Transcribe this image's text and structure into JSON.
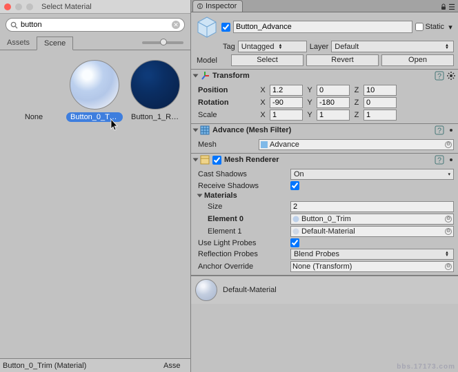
{
  "picker": {
    "title": "Select Material",
    "search_value": "button",
    "tabs": {
      "assets": "Assets",
      "scene": "Scene"
    },
    "items": {
      "none": "None",
      "sel": "Button_0_Tr…",
      "dark": "Button_1_Re..."
    },
    "footer_left": "Button_0_Trim (Material)",
    "footer_right": "Asse"
  },
  "inspector": {
    "tab": "Inspector",
    "name": "Button_Advance",
    "static_label": "Static",
    "tag_label": "Tag",
    "tag_value": "Untagged",
    "layer_label": "Layer",
    "layer_value": "Default",
    "model_label": "Model",
    "model_buttons": {
      "select": "Select",
      "revert": "Revert",
      "open": "Open"
    },
    "transform": {
      "title": "Transform",
      "position": {
        "label": "Position",
        "x": "1.2",
        "y": "0",
        "z": "10"
      },
      "rotation": {
        "label": "Rotation",
        "x": "-90",
        "y": "-180",
        "z": "0"
      },
      "scale": {
        "label": "Scale",
        "x": "1",
        "y": "1",
        "z": "1"
      },
      "axis": {
        "x": "X",
        "y": "Y",
        "z": "Z"
      }
    },
    "meshfilter": {
      "title": "Advance (Mesh Filter)",
      "mesh_label": "Mesh",
      "mesh_value": "Advance"
    },
    "renderer": {
      "title": "Mesh Renderer",
      "cast_label": "Cast Shadows",
      "cast_value": "On",
      "recv_label": "Receive Shadows",
      "materials_label": "Materials",
      "size_label": "Size",
      "size_value": "2",
      "el0_label": "Element 0",
      "el0_value": "Button_0_Trim",
      "el1_label": "Element 1",
      "el1_value": "Default-Material",
      "probes_label": "Use Light Probes",
      "refl_label": "Reflection Probes",
      "refl_value": "Blend Probes",
      "anchor_label": "Anchor Override",
      "anchor_value": "None (Transform)"
    },
    "mat_preview": "Default-Material"
  },
  "watermark": "bbs.17173.com"
}
